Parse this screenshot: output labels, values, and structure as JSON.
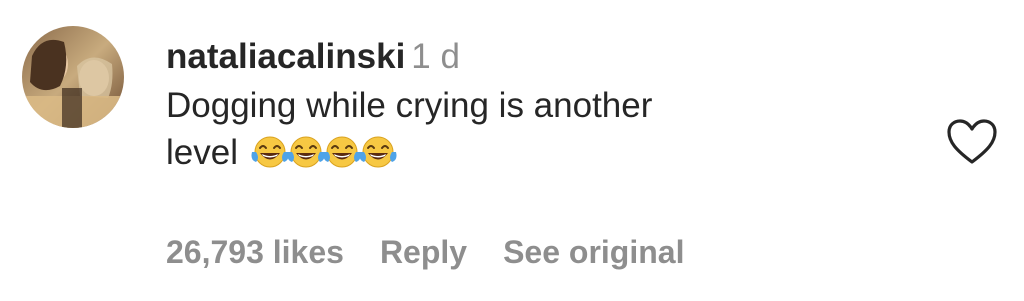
{
  "comment": {
    "username": "nataliacalinski",
    "timestamp": "1 d",
    "text_line1": "Dogging while crying is another",
    "text_line2": "level",
    "emojis": [
      "face-with-tears-of-joy-icon",
      "face-with-tears-of-joy-icon",
      "face-with-tears-of-joy-icon",
      "face-with-tears-of-joy-icon"
    ]
  },
  "actions": {
    "likes": "26,793 likes",
    "reply": "Reply",
    "see_original": "See original"
  },
  "icons": {
    "heart": "heart-outline-icon",
    "avatar": "profile-avatar"
  },
  "colors": {
    "primary_text": "#262626",
    "secondary_text": "#8e8e8e",
    "background": "#ffffff"
  }
}
